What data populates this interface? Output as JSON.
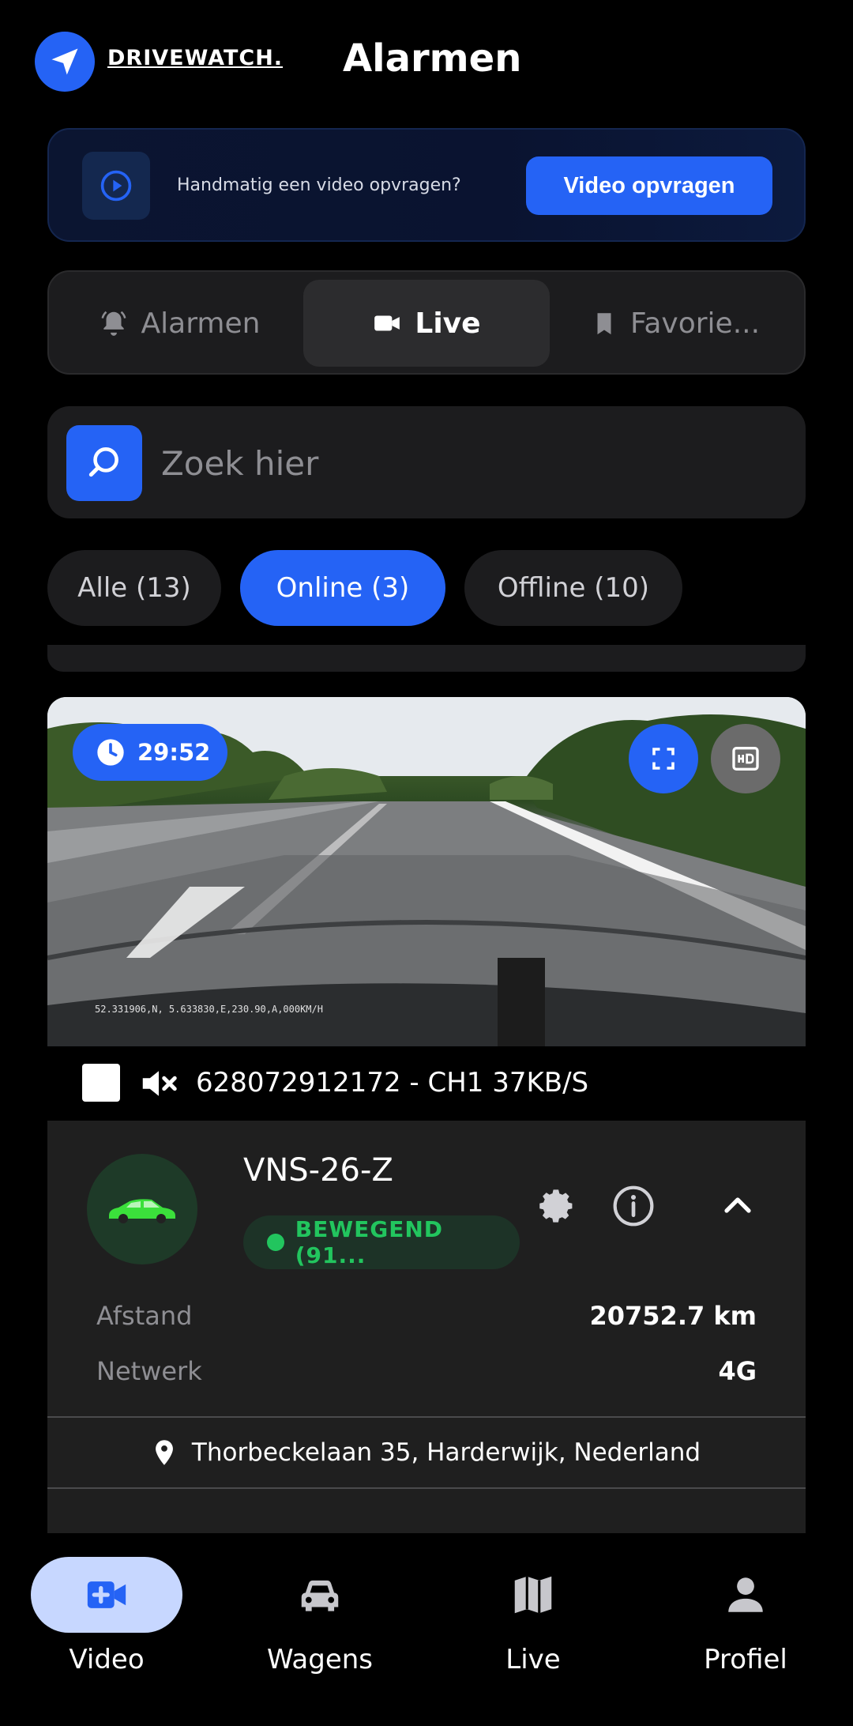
{
  "header": {
    "logo_text": "DRIVEWATCH.",
    "title": "Alarmen"
  },
  "banner": {
    "text": "Handmatig een video opvragen?",
    "button_label": "Video opvragen"
  },
  "tabs": [
    {
      "label": "Alarmen",
      "icon": "bell-icon",
      "active": false
    },
    {
      "label": "Live",
      "icon": "video-camera-icon",
      "active": true
    },
    {
      "label": "Favorie...",
      "icon": "bookmark-icon",
      "active": false
    }
  ],
  "search": {
    "placeholder": "Zoek hier",
    "value": ""
  },
  "filters": [
    {
      "label": "Alle (13)",
      "active": false
    },
    {
      "label": "Online (3)",
      "active": true
    },
    {
      "label": "Offline (10)",
      "active": false
    }
  ],
  "card": {
    "timer": "29:52",
    "video_overlay": "52.331906,N,   5.633830,E,230.90,A,000KM/H",
    "stream_label": "628072912172 - CH1 37KB/S",
    "plate": "VNS-26-Z",
    "status": "BEWEGEND (91...",
    "details": [
      {
        "label": "Afstand",
        "value": "20752.7 km"
      },
      {
        "label": "Netwerk",
        "value": "4G"
      }
    ],
    "address": "Thorbeckelaan 35, Harderwijk, Nederland"
  },
  "bottom_nav": [
    {
      "label": "Video",
      "icon": "video-add-icon",
      "active": true
    },
    {
      "label": "Wagens",
      "icon": "car-icon",
      "active": false
    },
    {
      "label": "Live",
      "icon": "map-icon",
      "active": false
    },
    {
      "label": "Profiel",
      "icon": "person-icon",
      "active": false
    }
  ],
  "colors": {
    "accent": "#2563f5",
    "status_green": "#22c55e",
    "background": "#000000",
    "surface": "#1c1c1e"
  }
}
